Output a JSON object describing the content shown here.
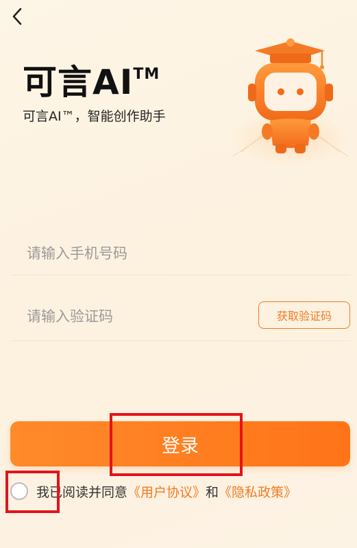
{
  "nav": {
    "back_icon": "chevron-left-icon"
  },
  "header": {
    "title": "可言AI",
    "title_tm": "TM",
    "subtitle": "可言AI™，智能创作助手"
  },
  "mascot": {
    "icon": "robot-mascot-graduation-cap"
  },
  "form": {
    "phone_placeholder": "请输入手机号码",
    "code_placeholder": "请输入验证码",
    "get_code_label": "获取验证码",
    "login_label": "登录"
  },
  "agreement": {
    "prefix": "我已阅读并同意",
    "user_agreement": "《用户协议》",
    "and": "和",
    "privacy_policy": "《隐私政策》",
    "checked": false
  },
  "colors": {
    "accent": "#f07b25",
    "button_start": "#ff8a2a",
    "button_end": "#ff7418",
    "highlight": "#e3131c"
  }
}
